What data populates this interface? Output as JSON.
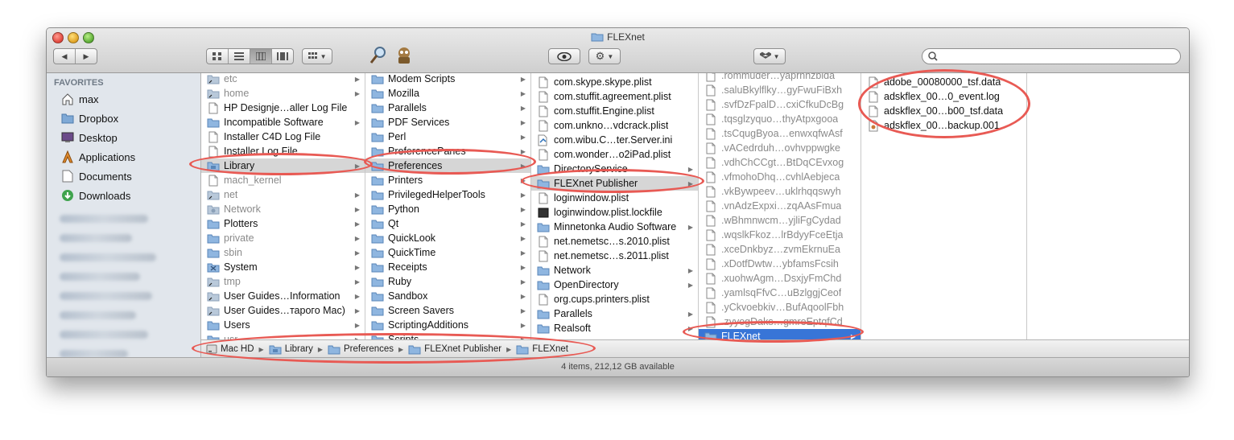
{
  "window": {
    "title": "FLEXnet",
    "status": "4 items, 212,12 GB available"
  },
  "toolbar": {
    "back": "◀",
    "forward": "▶",
    "views": [
      "icon-view",
      "list-view",
      "column-view",
      "coverflow-view"
    ],
    "active_view": "column-view",
    "search_placeholder": ""
  },
  "sidebar": {
    "heading": "FAVORITES",
    "items": [
      {
        "label": "max",
        "icon": "home-icon"
      },
      {
        "label": "Dropbox",
        "icon": "folder-icon"
      },
      {
        "label": "Desktop",
        "icon": "desktop-icon"
      },
      {
        "label": "Applications",
        "icon": "applications-icon"
      },
      {
        "label": "Documents",
        "icon": "document-icon"
      },
      {
        "label": "Downloads",
        "icon": "downloads-icon"
      }
    ]
  },
  "columns": [
    {
      "items": [
        {
          "label": "etc",
          "icon": "alias",
          "arrow": true,
          "dim": true
        },
        {
          "label": "home",
          "icon": "alias",
          "arrow": true,
          "dim": true
        },
        {
          "label": "HP Designje…aller Log File",
          "icon": "doc"
        },
        {
          "label": "Incompatible Software",
          "icon": "folder",
          "arrow": true
        },
        {
          "label": "Installer C4D Log File",
          "icon": "doc"
        },
        {
          "label": "Installer Log File",
          "icon": "doc"
        },
        {
          "label": "Library",
          "icon": "library",
          "arrow": true,
          "selected": true
        },
        {
          "label": "mach_kernel",
          "icon": "doc",
          "dim": true
        },
        {
          "label": "net",
          "icon": "alias",
          "arrow": true,
          "dim": true
        },
        {
          "label": "Network",
          "icon": "network",
          "arrow": true,
          "dim": true
        },
        {
          "label": "Plotters",
          "icon": "folder",
          "arrow": true
        },
        {
          "label": "private",
          "icon": "folder",
          "arrow": true,
          "dim": true
        },
        {
          "label": "sbin",
          "icon": "folder",
          "arrow": true,
          "dim": true
        },
        {
          "label": "System",
          "icon": "system",
          "arrow": true
        },
        {
          "label": "tmp",
          "icon": "alias",
          "arrow": true,
          "dim": true
        },
        {
          "label": "User Guides…Information",
          "icon": "alias",
          "arrow": true
        },
        {
          "label": "User Guides…тарого Mac)",
          "icon": "alias",
          "arrow": true
        },
        {
          "label": "Users",
          "icon": "folder",
          "arrow": true
        },
        {
          "label": "usr",
          "icon": "folder",
          "arrow": true,
          "dim": true
        }
      ]
    },
    {
      "items": [
        {
          "label": "Modem Scripts",
          "icon": "folder",
          "arrow": true
        },
        {
          "label": "Mozilla",
          "icon": "folder",
          "arrow": true
        },
        {
          "label": "Parallels",
          "icon": "folder",
          "arrow": true
        },
        {
          "label": "PDF Services",
          "icon": "folder",
          "arrow": true
        },
        {
          "label": "Perl",
          "icon": "folder",
          "arrow": true
        },
        {
          "label": "PreferencePanes",
          "icon": "folder",
          "arrow": true
        },
        {
          "label": "Preferences",
          "icon": "folder",
          "arrow": true,
          "selected": true
        },
        {
          "label": "Printers",
          "icon": "folder",
          "arrow": true
        },
        {
          "label": "PrivilegedHelperTools",
          "icon": "folder",
          "arrow": true
        },
        {
          "label": "Python",
          "icon": "folder",
          "arrow": true
        },
        {
          "label": "Qt",
          "icon": "folder",
          "arrow": true
        },
        {
          "label": "QuickLook",
          "icon": "folder",
          "arrow": true
        },
        {
          "label": "QuickTime",
          "icon": "folder",
          "arrow": true
        },
        {
          "label": "Receipts",
          "icon": "folder",
          "arrow": true
        },
        {
          "label": "Ruby",
          "icon": "folder",
          "arrow": true
        },
        {
          "label": "Sandbox",
          "icon": "folder",
          "arrow": true
        },
        {
          "label": "Screen Savers",
          "icon": "folder",
          "arrow": true
        },
        {
          "label": "ScriptingAdditions",
          "icon": "folder",
          "arrow": true
        },
        {
          "label": "Scripts",
          "icon": "folder",
          "arrow": true
        }
      ]
    },
    {
      "items": [
        {
          "label": "com.skype.skype.plist",
          "icon": "doc"
        },
        {
          "label": "com.stuffit.agreement.plist",
          "icon": "doc"
        },
        {
          "label": "com.stuffit.Engine.plist",
          "icon": "doc"
        },
        {
          "label": "com.unkno…vdcrack.plist",
          "icon": "doc"
        },
        {
          "label": "com.wibu.C…ter.Server.ini",
          "icon": "ini"
        },
        {
          "label": "com.wonder…o2iPad.plist",
          "icon": "doc"
        },
        {
          "label": "DirectoryService",
          "icon": "folder",
          "arrow": true
        },
        {
          "label": "FLEXnet Publisher",
          "icon": "folder",
          "arrow": true,
          "selected": true
        },
        {
          "label": "loginwindow.plist",
          "icon": "doc"
        },
        {
          "label": "loginwindow.plist.lockfile",
          "icon": "black"
        },
        {
          "label": "Minnetonka Audio Software",
          "icon": "folder",
          "arrow": true
        },
        {
          "label": "net.nemetsc…s.2010.plist",
          "icon": "doc"
        },
        {
          "label": "net.nemetsc…s.2011.plist",
          "icon": "doc"
        },
        {
          "label": "Network",
          "icon": "folder",
          "arrow": true
        },
        {
          "label": "OpenDirectory",
          "icon": "folder",
          "arrow": true
        },
        {
          "label": "org.cups.printers.plist",
          "icon": "doc"
        },
        {
          "label": "Parallels",
          "icon": "folder",
          "arrow": true
        },
        {
          "label": "Realsoft",
          "icon": "folder",
          "arrow": true
        }
      ]
    },
    {
      "items": [
        {
          "label": ".rommuder…yaprnnzbida",
          "icon": "doc",
          "dim": true
        },
        {
          "label": ".saluBkylflky…gyFwuFiBxh",
          "icon": "doc",
          "dim": true
        },
        {
          "label": ".svfDzFpalD…cxiCfkuDcBg",
          "icon": "doc",
          "dim": true
        },
        {
          "label": ".tqsglzyquo…thyAtpxgooa",
          "icon": "doc",
          "dim": true
        },
        {
          "label": ".tsCqugByoa…enwxqfwAsf",
          "icon": "doc",
          "dim": true
        },
        {
          "label": ".vACedrduh…ovhvppwgke",
          "icon": "doc",
          "dim": true
        },
        {
          "label": ".vdhChCCgt…BtDqCEvxog",
          "icon": "doc",
          "dim": true
        },
        {
          "label": ".vfmohoDhq…cvhlAebjeca",
          "icon": "doc",
          "dim": true
        },
        {
          "label": ".vkBywpeev…uklrhqqswyh",
          "icon": "doc",
          "dim": true
        },
        {
          "label": ".vnAdzExpxi…zqAAsFmua",
          "icon": "doc",
          "dim": true
        },
        {
          "label": ".wBhmnwcm…yjliFgCydad",
          "icon": "doc",
          "dim": true
        },
        {
          "label": ".wqslkFkoz…lrBdyyFceEtja",
          "icon": "doc",
          "dim": true
        },
        {
          "label": ".xceDnkbyz…zvmEkrnuEa",
          "icon": "doc",
          "dim": true
        },
        {
          "label": ".xDotfDwtw…ybfamsFcsih",
          "icon": "doc",
          "dim": true
        },
        {
          "label": ".xuohwAgm…DsxjyFmChd",
          "icon": "doc",
          "dim": true
        },
        {
          "label": ".yamlsqFfvC…uBzlggjCeof",
          "icon": "doc",
          "dim": true
        },
        {
          "label": ".yCkvoebkiv…BufAqoolFbh",
          "icon": "doc",
          "dim": true
        },
        {
          "label": ".zyyogDaks…gmreEptqfCd",
          "icon": "doc",
          "dim": true
        },
        {
          "label": "FLEXnet",
          "icon": "folder",
          "arrow": true,
          "selected_blue": true
        }
      ]
    },
    {
      "items": [
        {
          "label": "adobe_00080000_tsf.data",
          "icon": "doc"
        },
        {
          "label": "adskflex_00…0_event.log",
          "icon": "doc"
        },
        {
          "label": "adskflex_00…b00_tsf.data",
          "icon": "doc"
        },
        {
          "label": "adskflex_00…backup.001",
          "icon": "doc2"
        }
      ]
    }
  ],
  "pathbar": [
    {
      "label": "Mac HD",
      "icon": "disk"
    },
    {
      "label": "Library",
      "icon": "library"
    },
    {
      "label": "Preferences",
      "icon": "folder"
    },
    {
      "label": "FLEXnet Publisher",
      "icon": "folder"
    },
    {
      "label": "FLEXnet",
      "icon": "folder"
    }
  ],
  "colors": {
    "selection_blue": "#3875d7",
    "selection_gray": "#d6d6d6",
    "annotation_red": "#e85a54",
    "sidebar_bg": "#e1e6ec"
  }
}
